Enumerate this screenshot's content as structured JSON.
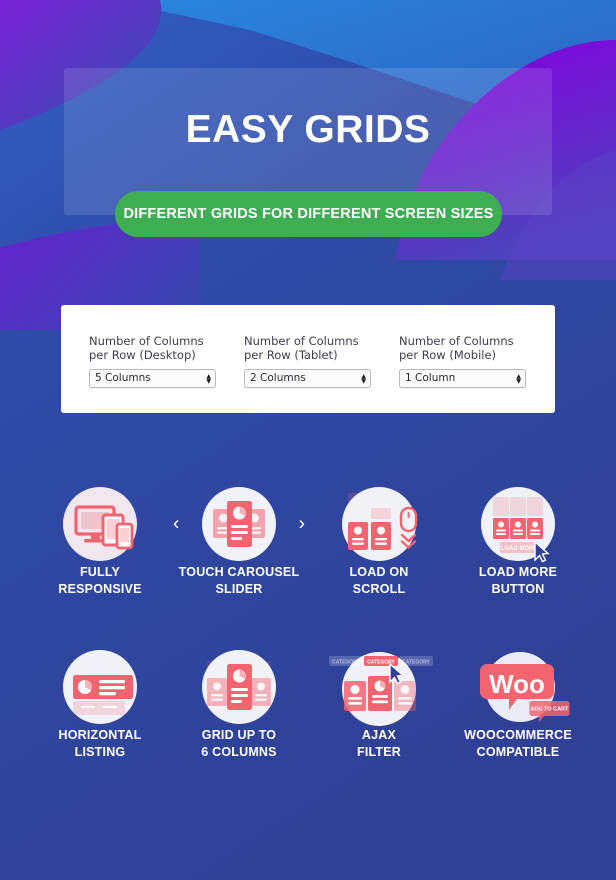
{
  "hero": {
    "title": "EASY GRIDS",
    "button_label": "DIFFERENT GRIDS FOR DIFFERENT SCREEN SIZES",
    "button_color": "#3eae52"
  },
  "settings": {
    "groups": [
      {
        "label_line1": "Number of Columns",
        "label_line2": "per Row (Desktop)",
        "value": "5 Columns"
      },
      {
        "label_line1": "Number of Columns",
        "label_line2": "per Row (Tablet)",
        "value": "2 Columns"
      },
      {
        "label_line1": "Number of Columns",
        "label_line2": "per Row (Mobile)",
        "value": "1 Column"
      }
    ]
  },
  "features": [
    {
      "icon": "responsive-devices-icon",
      "line1": "FULLY",
      "line2": "RESPONSIVE"
    },
    {
      "icon": "carousel-slider-icon",
      "line1": "TOUCH CAROUSEL",
      "line2": "SLIDER",
      "arrow_left": "‹",
      "arrow_right": "›"
    },
    {
      "icon": "mouse-scroll-icon",
      "line1": "LOAD ON",
      "line2": "SCROLL"
    },
    {
      "icon": "load-more-button-icon",
      "line1": "LOAD MORE",
      "line2": "BUTTON",
      "badge": "LOAD MORE"
    },
    {
      "icon": "horizontal-listing-icon",
      "line1": "HORIZONTAL",
      "line2": "LISTING"
    },
    {
      "icon": "grid-columns-icon",
      "line1": "GRID UP TO",
      "line2": "6 COLUMNS"
    },
    {
      "icon": "ajax-filter-icon",
      "line1": "AJAX",
      "line2": "FILTER",
      "badge": "CATEGORY"
    },
    {
      "icon": "woocommerce-icon",
      "line1": "WOOCOMMERCE",
      "line2": "COMPATIBLE",
      "badge": "Woo",
      "badge2": "ADD TO CART"
    }
  ],
  "colors": {
    "background_blue": "#2f4096",
    "accent_purple": "#7d00d4",
    "sky_blue": "#2478d4",
    "icon_pink": "#f2646f",
    "card_white": "#ffffff"
  }
}
